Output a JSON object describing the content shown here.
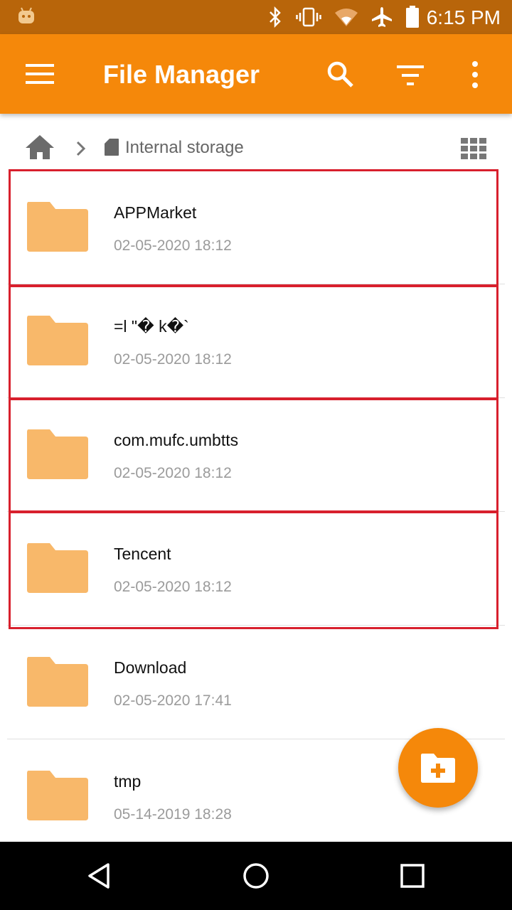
{
  "status_bar": {
    "time": "6:15 PM",
    "icons": [
      "android-robot-icon",
      "bluetooth-icon",
      "vibrate-icon",
      "wifi-icon",
      "airplane-icon",
      "battery-icon"
    ]
  },
  "app_bar": {
    "title": "File Manager",
    "icons": [
      "menu-icon",
      "search-icon",
      "filter-icon",
      "more-vert-icon"
    ]
  },
  "breadcrumb": {
    "items": [
      "home-icon",
      "Internal storage"
    ],
    "view_toggle_icon": "grid-view-icon"
  },
  "files": [
    {
      "name": "APPMarket",
      "date": "02-05-2020 18:12",
      "icon": "folder-icon"
    },
    {
      "name": "=l \"� k�`",
      "date": "02-05-2020 18:12",
      "icon": "folder-icon"
    },
    {
      "name": "com.mufc.umbtts",
      "date": "02-05-2020 18:12",
      "icon": "folder-icon"
    },
    {
      "name": "Tencent",
      "date": "02-05-2020 18:12",
      "icon": "folder-icon"
    },
    {
      "name": "Download",
      "date": "02-05-2020 17:41",
      "icon": "folder-icon"
    },
    {
      "name": "tmp",
      "date": "05-14-2019 18:28",
      "icon": "folder-icon"
    }
  ],
  "fab": {
    "icon": "new-folder-icon"
  },
  "nav_bar": {
    "icons": [
      "back-icon",
      "home-circle-icon",
      "recents-icon"
    ]
  },
  "colors": {
    "status_bar": "#b8650a",
    "app_bar": "#f5880a",
    "folder": "#f8b86a",
    "highlight": "#d8202d"
  }
}
